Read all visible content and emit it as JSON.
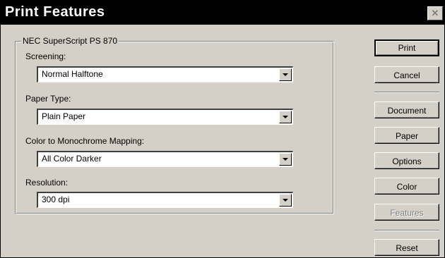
{
  "window": {
    "title": "Print Features",
    "close_glyph": "✕"
  },
  "group": {
    "legend": "NEC SuperScript PS 870",
    "fields": [
      {
        "label": "Screening:",
        "value": "Normal Halftone"
      },
      {
        "label": "Paper Type:",
        "value": "Plain Paper"
      },
      {
        "label": "Color to Monochrome Mapping:",
        "value": "All Color Darker"
      },
      {
        "label": "Resolution:",
        "value": "300 dpi"
      }
    ]
  },
  "buttons": {
    "print": "Print",
    "cancel": "Cancel",
    "document": "Document",
    "paper": "Paper",
    "options": "Options",
    "color": "Color",
    "features": "Features",
    "reset": "Reset"
  },
  "colors": {
    "face": "#d4d0c8",
    "titlebar": "#000000",
    "disabled_text": "#808080"
  }
}
